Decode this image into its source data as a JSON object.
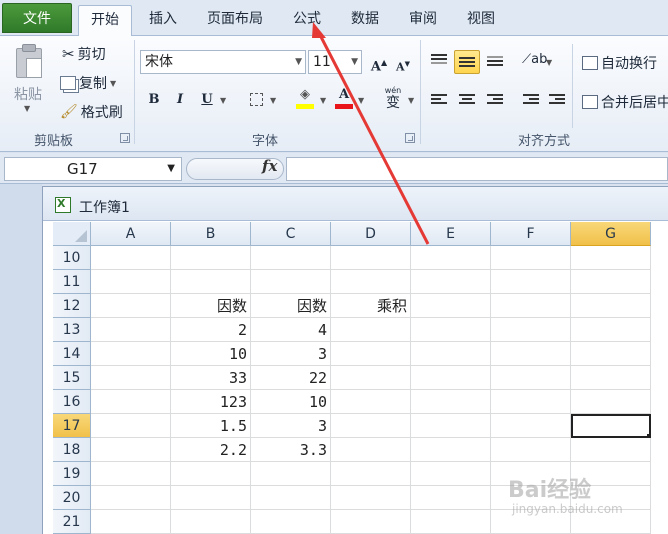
{
  "tabs": [
    {
      "label": "文件",
      "kind": "file"
    },
    {
      "label": "开始",
      "kind": "active"
    },
    {
      "label": "插入",
      "kind": "normal"
    },
    {
      "label": "页面布局",
      "kind": "normal"
    },
    {
      "label": "公式",
      "kind": "normal"
    },
    {
      "label": "数据",
      "kind": "normal"
    },
    {
      "label": "审阅",
      "kind": "normal"
    },
    {
      "label": "视图",
      "kind": "normal"
    }
  ],
  "clipboard": {
    "paste_label": "粘贴",
    "cut_label": "剪切",
    "copy_label": "复制",
    "format_painter_label": "格式刷",
    "group_label": "剪贴板"
  },
  "font": {
    "font_name": "宋体",
    "font_size": "11",
    "bold": "B",
    "italic": "I",
    "underline": "U",
    "group_label": "字体",
    "font_color_glyph": "A",
    "phonetic_glyph": "wén",
    "phonetic_base": "变"
  },
  "alignment": {
    "wrap_text_label": "自动换行",
    "merge_center_label": "合并后居中",
    "group_label": "对齐方式"
  },
  "formula_bar": {
    "name_box": "G17",
    "fx_label": "fx",
    "formula": ""
  },
  "workbook": {
    "title": "工作簿1",
    "columns": [
      "A",
      "B",
      "C",
      "D",
      "E",
      "F",
      "G"
    ],
    "selected_column": "G",
    "rows": [
      {
        "n": "10",
        "cells": [
          "",
          "",
          "",
          "",
          "",
          "",
          ""
        ]
      },
      {
        "n": "11",
        "cells": [
          "",
          "",
          "",
          "",
          "",
          "",
          ""
        ]
      },
      {
        "n": "12",
        "cells": [
          "",
          "因数",
          "因数",
          "乘积",
          "",
          "",
          ""
        ]
      },
      {
        "n": "13",
        "cells": [
          "",
          "2",
          "4",
          "",
          "",
          "",
          ""
        ]
      },
      {
        "n": "14",
        "cells": [
          "",
          "10",
          "3",
          "",
          "",
          "",
          ""
        ]
      },
      {
        "n": "15",
        "cells": [
          "",
          "33",
          "22",
          "",
          "",
          "",
          ""
        ]
      },
      {
        "n": "16",
        "cells": [
          "",
          "123",
          "10",
          "",
          "",
          "",
          ""
        ]
      },
      {
        "n": "17",
        "cells": [
          "",
          "1.5",
          "3",
          "",
          "",
          "",
          ""
        ]
      },
      {
        "n": "18",
        "cells": [
          "",
          "2.2",
          "3.3",
          "",
          "",
          "",
          ""
        ]
      },
      {
        "n": "19",
        "cells": [
          "",
          "",
          "",
          "",
          "",
          "",
          ""
        ]
      },
      {
        "n": "20",
        "cells": [
          "",
          "",
          "",
          "",
          "",
          "",
          ""
        ]
      },
      {
        "n": "21",
        "cells": [
          "",
          "",
          "",
          "",
          "",
          "",
          ""
        ]
      }
    ],
    "selected_row": "17"
  },
  "annotation": {
    "color": "#e53935"
  },
  "watermark": {
    "main": "Bai经验",
    "sub": "jingyan.baidu.com"
  },
  "colors": {
    "file_tab": "#2f7a2a",
    "selection": "#f1c04a",
    "accent": "#e53935"
  }
}
